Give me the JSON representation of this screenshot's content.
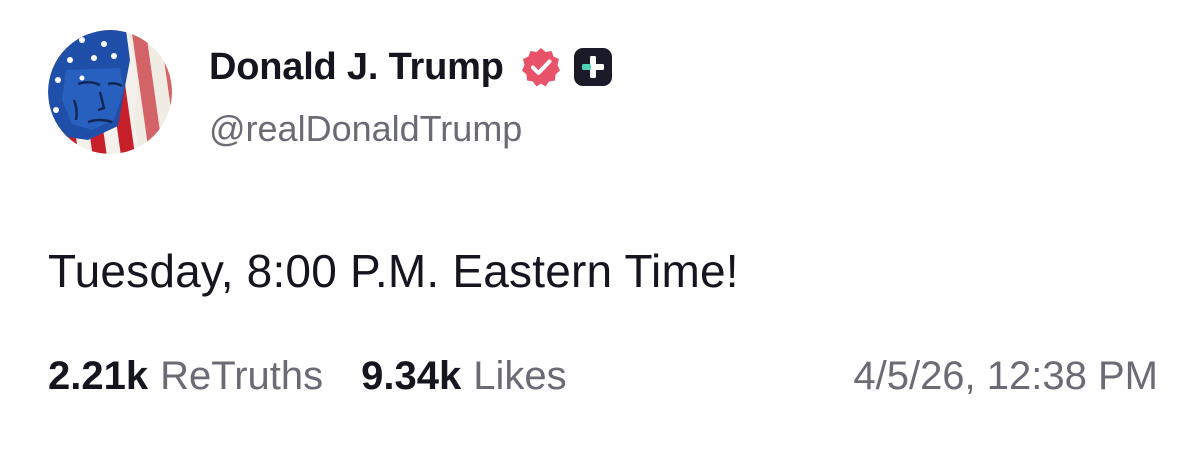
{
  "post": {
    "author": {
      "display_name": "Donald J. Trump",
      "handle": "@realDonaldTrump",
      "verified_icon": "verified-badge-icon",
      "plus_icon": "truth-plus-icon"
    },
    "text": "Tuesday, 8:00 P.M. Eastern Time!",
    "stats": {
      "retruths_count": "2.21k",
      "retruths_label": "ReTruths",
      "likes_count": "9.34k",
      "likes_label": "Likes"
    },
    "timestamp": "4/5/26, 12:38 PM"
  },
  "colors": {
    "verified_badge": "#e8536a",
    "plus_badge_bg": "#1a1a28",
    "plus_badge_accent": "#4fd1b5",
    "text_primary": "#15151f",
    "text_secondary": "#6b6b75"
  }
}
